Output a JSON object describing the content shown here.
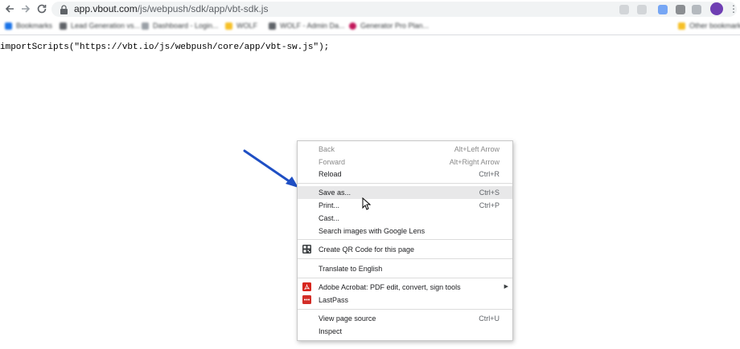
{
  "browser": {
    "url_host": "app.vbout.com",
    "url_path": "/js/webpush/sdk/app/vbt-sdk.js",
    "back_icon": "back-arrow-icon",
    "forward_icon": "forward-arrow-icon",
    "reload_icon": "reload-icon"
  },
  "bookmarks": [
    {
      "label": "Bookmarks",
      "color": "#1a73e8"
    },
    {
      "label": "Lead Generation vs...",
      "color": "#5f6368"
    },
    {
      "label": "Dashboard - Login...",
      "color": "#9aa0a6"
    },
    {
      "label": "WOLF",
      "color": "#f6c026"
    },
    {
      "label": "WOLF - Admin Da...",
      "color": "#5f6368"
    },
    {
      "label": "Generator Pro Plan...",
      "color": "#c2185b"
    },
    {
      "label": "Other bookmarks",
      "color": "#f6c026"
    }
  ],
  "page": {
    "code_line": "importScripts(\"https://vbt.io/js/webpush/core/app/vbt-sw.js\");"
  },
  "context_menu": {
    "back": {
      "label": "Back",
      "shortcut": "Alt+Left Arrow"
    },
    "forward": {
      "label": "Forward",
      "shortcut": "Alt+Right Arrow"
    },
    "reload": {
      "label": "Reload",
      "shortcut": "Ctrl+R"
    },
    "save_as": {
      "label": "Save as...",
      "shortcut": "Ctrl+S"
    },
    "print": {
      "label": "Print...",
      "shortcut": "Ctrl+P"
    },
    "cast": {
      "label": "Cast..."
    },
    "search_lens": {
      "label": "Search images with Google Lens"
    },
    "qr_code": {
      "label": "Create QR Code for this page"
    },
    "translate": {
      "label": "Translate to English"
    },
    "acrobat": {
      "label": "Adobe Acrobat: PDF edit, convert, sign tools"
    },
    "lastpass": {
      "label": "LastPass"
    },
    "view_source": {
      "label": "View page source",
      "shortcut": "Ctrl+U"
    },
    "inspect": {
      "label": "Inspect"
    }
  },
  "colors": {
    "arrow": "#1f4fc4",
    "acrobat": "#d7261e",
    "lastpass": "#d32d27",
    "menu_hover": "#e8e8e9"
  }
}
